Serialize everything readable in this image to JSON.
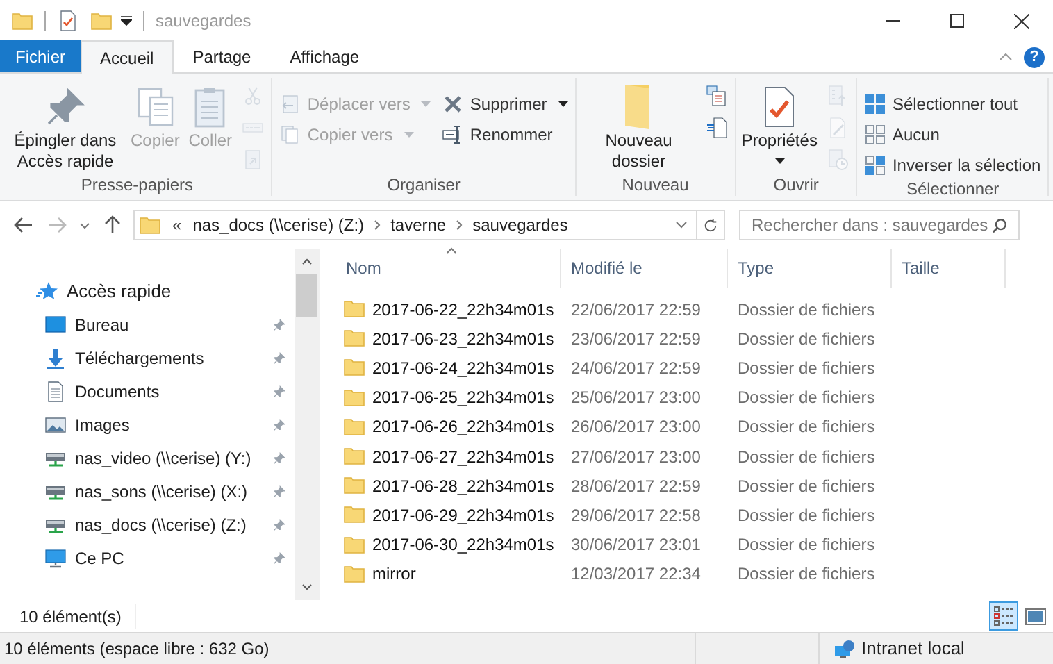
{
  "window": {
    "title": "sauvegardes"
  },
  "tabs": [
    {
      "label": "Fichier",
      "kind": "file",
      "selected": false
    },
    {
      "label": "Accueil",
      "kind": "tab",
      "selected": true
    },
    {
      "label": "Partage",
      "kind": "tab",
      "selected": false
    },
    {
      "label": "Affichage",
      "kind": "tab",
      "selected": false
    }
  ],
  "help": "?",
  "ribbon": [
    {
      "label": "Presse-papiers",
      "items": [
        {
          "kind": "large",
          "label": "Épingler dans Accès rapide",
          "disabled": false
        },
        {
          "kind": "large",
          "label": "Copier",
          "disabled": true
        },
        {
          "kind": "large",
          "label": "Coller",
          "disabled": true
        },
        {
          "kind": "stack",
          "buttons": [
            {
              "disabled": true
            },
            {
              "disabled": true
            },
            {
              "disabled": true
            }
          ]
        }
      ]
    },
    {
      "label": "Organiser",
      "items": [
        {
          "kind": "column",
          "rows": [
            {
              "label": "Déplacer vers",
              "disabled": true,
              "dropdown": true
            },
            {
              "label": "Copier vers",
              "disabled": true,
              "dropdown": true
            }
          ]
        },
        {
          "kind": "column",
          "rows": [
            {
              "label": "Supprimer",
              "disabled": false,
              "dropdown": true
            },
            {
              "label": "Renommer",
              "disabled": false,
              "dropdown": false
            }
          ]
        }
      ]
    },
    {
      "label": "Nouveau",
      "items": [
        {
          "kind": "large",
          "label": "Nouveau dossier",
          "disabled": false,
          "dropdown": false
        },
        {
          "kind": "stack",
          "buttons": [
            {
              "disabled": false
            },
            {
              "disabled": false
            }
          ]
        }
      ]
    },
    {
      "label": "Ouvrir",
      "items": [
        {
          "kind": "large",
          "label": "Propriétés",
          "disabled": false,
          "dropdown": true
        },
        {
          "kind": "stack",
          "buttons": [
            {
              "disabled": true
            },
            {
              "disabled": true
            },
            {
              "disabled": true
            }
          ]
        }
      ]
    },
    {
      "label": "Sélectionner",
      "items": [
        {
          "kind": "column",
          "rows": [
            {
              "label": "Sélectionner tout",
              "disabled": false,
              "dropdown": false
            },
            {
              "label": "Aucun",
              "disabled": false,
              "dropdown": false
            },
            {
              "label": "Inverser la sélection",
              "disabled": false,
              "dropdown": false
            }
          ]
        }
      ]
    }
  ],
  "address": {
    "overflow": "«",
    "crumbs": [
      "nas_docs (\\\\cerise) (Z:)",
      "taverne",
      "sauvegardes"
    ]
  },
  "search": {
    "placeholder": "Rechercher dans : sauvegardes"
  },
  "sidebar": {
    "items": [
      {
        "label": "Accès rapide",
        "kind": "favorites",
        "pinned": false
      },
      {
        "label": "Bureau",
        "kind": "desktop",
        "pinned": true
      },
      {
        "label": "Téléchargements",
        "kind": "downloads",
        "pinned": true
      },
      {
        "label": "Documents",
        "kind": "documents",
        "pinned": true
      },
      {
        "label": "Images",
        "kind": "pictures",
        "pinned": true
      },
      {
        "label": "nas_video (\\\\cerise) (Y:)",
        "kind": "drive",
        "pinned": true
      },
      {
        "label": "nas_sons (\\\\cerise) (X:)",
        "kind": "drive",
        "pinned": true
      },
      {
        "label": "nas_docs (\\\\cerise) (Z:)",
        "kind": "drive",
        "pinned": true
      },
      {
        "label": "Ce PC",
        "kind": "computer",
        "pinned": true
      }
    ]
  },
  "table": {
    "columns": [
      "Nom",
      "Modifié le",
      "Type",
      "Taille"
    ],
    "rows": [
      [
        "2017-06-22_22h34m01s",
        "22/06/2017 22:59",
        "Dossier de fichiers"
      ],
      [
        "2017-06-23_22h34m01s",
        "23/06/2017 22:59",
        "Dossier de fichiers"
      ],
      [
        "2017-06-24_22h34m01s",
        "24/06/2017 22:59",
        "Dossier de fichiers"
      ],
      [
        "2017-06-25_22h34m01s",
        "25/06/2017 23:00",
        "Dossier de fichiers"
      ],
      [
        "2017-06-26_22h34m01s",
        "26/06/2017 23:00",
        "Dossier de fichiers"
      ],
      [
        "2017-06-27_22h34m01s",
        "27/06/2017 23:00",
        "Dossier de fichiers"
      ],
      [
        "2017-06-28_22h34m01s",
        "28/06/2017 22:59",
        "Dossier de fichiers"
      ],
      [
        "2017-06-29_22h34m01s",
        "29/06/2017 22:58",
        "Dossier de fichiers"
      ],
      [
        "2017-06-30_22h34m01s",
        "30/06/2017 23:01",
        "Dossier de fichiers"
      ],
      [
        "mirror",
        "12/03/2017 22:34",
        "Dossier de fichiers"
      ]
    ]
  },
  "item_count": "10 élément(s)",
  "views": [
    {
      "kind": "details",
      "selected": true
    },
    {
      "kind": "large",
      "selected": false
    }
  ],
  "status_bar": {
    "text": "10 éléments (espace libre : 632 Go)",
    "zone": "Intranet local"
  }
}
